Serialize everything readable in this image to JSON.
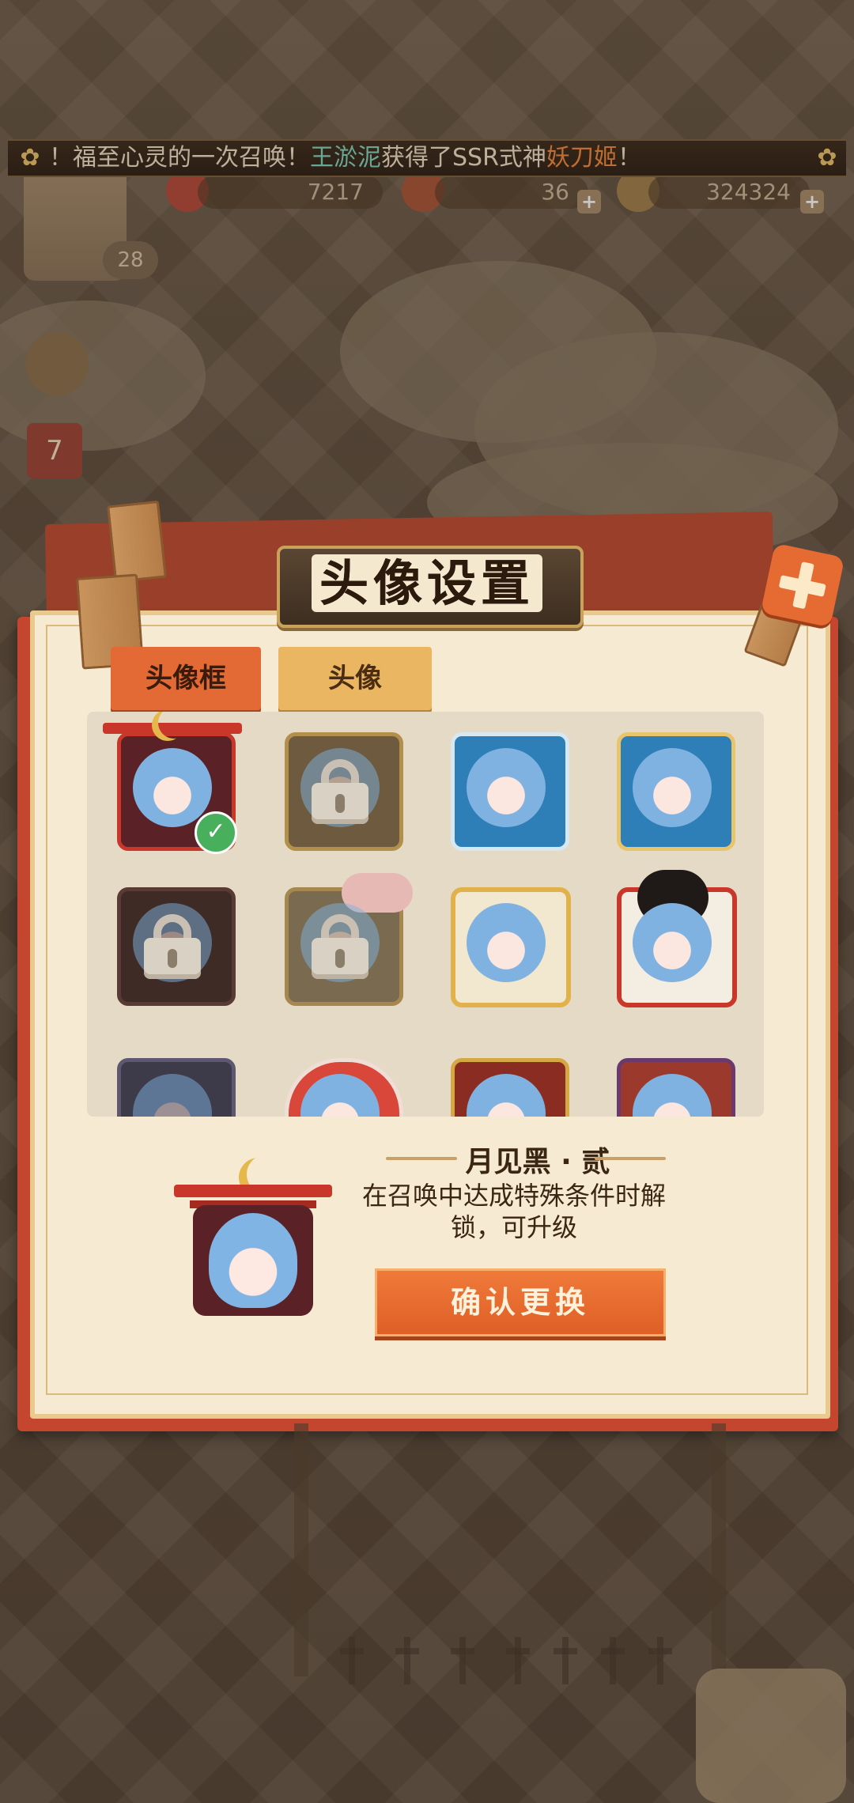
{
  "banner": {
    "prefix": "！福至心灵的一次召唤！",
    "player": "王淤泥",
    "middle": "获得了SSR式神",
    "shikigami": "妖刀姬",
    "suffix": "！"
  },
  "resources": {
    "stamina": "7217",
    "gouyu": "36",
    "coins": "324324"
  },
  "player_level": "28",
  "side_badge": "7",
  "dialog": {
    "title": "头像设置",
    "tabs": [
      "头像框",
      "头像"
    ],
    "active_tab": "头像框"
  },
  "frames": [
    {
      "state": "selected"
    },
    {
      "state": "locked"
    },
    {
      "state": "owned"
    },
    {
      "state": "owned"
    },
    {
      "state": "locked"
    },
    {
      "state": "locked"
    },
    {
      "state": "owned"
    },
    {
      "state": "owned"
    },
    {
      "state": "partial"
    },
    {
      "state": "partial"
    },
    {
      "state": "partial"
    },
    {
      "state": "partial"
    }
  ],
  "selected_frame": {
    "name": "月见黑 · 贰",
    "description": "在召唤中达成特殊条件时解锁，可升级"
  },
  "confirm_label": "确认更换",
  "colors": {
    "accent": "#e46a35",
    "panel": "#f6ead2",
    "dialog_border": "#c4462f",
    "check": "#48b05c"
  }
}
